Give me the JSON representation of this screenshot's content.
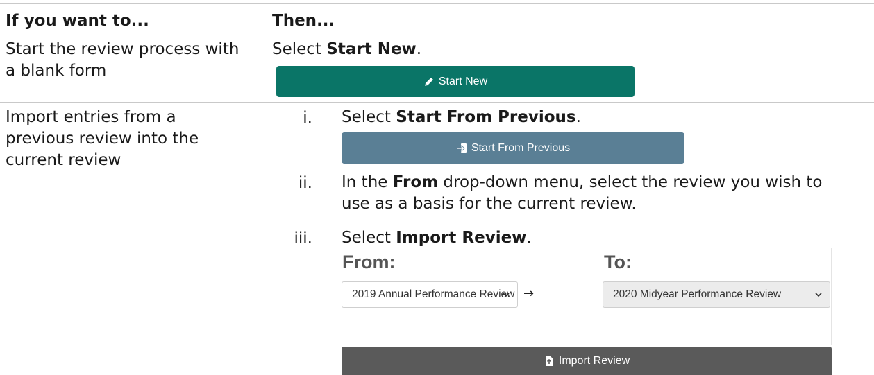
{
  "table": {
    "headers": [
      "If you want to...",
      "Then..."
    ],
    "rows": [
      {
        "condition": "Start the review process with a blank form",
        "select_prefix": "Select ",
        "select_bold": "Start New",
        "select_suffix": ".",
        "button_label": "Start New",
        "button_icon": "pencil-icon"
      },
      {
        "condition": "Import entries from a previous review into the current review",
        "steps": [
          {
            "num": "i.",
            "pre": "Select ",
            "bold": "Start From Previous",
            "post": "."
          },
          {
            "num": "ii.",
            "pre": "In the ",
            "bold": "From",
            "post": " drop-down menu, select the review you wish to use as a basis for the current review."
          },
          {
            "num": "iii.",
            "pre": "Select ",
            "bold": "Import Review",
            "post": "."
          }
        ],
        "prev_button_label": "Start From Previous",
        "prev_button_icon": "sign-in-icon",
        "panel": {
          "from_label": "From:",
          "to_label": "To:",
          "from_value": "2019 Annual Performance Review",
          "to_value": "2020 Midyear Performance Review",
          "import_label": "Import Review",
          "import_icon": "file-import-icon"
        }
      }
    ]
  },
  "colors": {
    "start_new": "#0a7567",
    "start_previous": "#5a7f95",
    "import": "#5a5a5a"
  }
}
